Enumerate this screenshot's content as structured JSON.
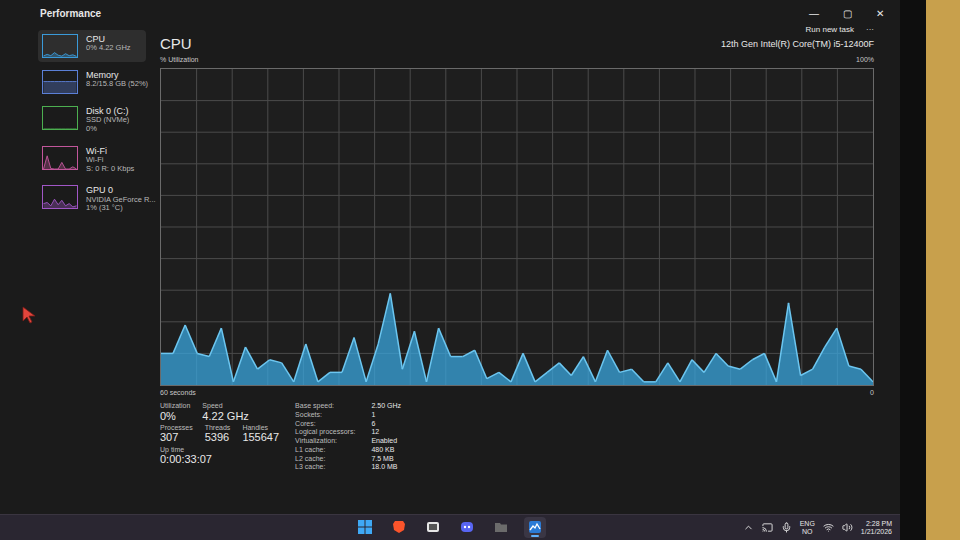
{
  "window": {
    "title": "Performance",
    "controls": [
      "—",
      "▢",
      "✕"
    ]
  },
  "toolbar": {
    "run_task": "Run new task",
    "more": "···"
  },
  "sidebar": {
    "items": [
      {
        "name": "CPU",
        "lines": [
          "0% 4.22 GHz"
        ],
        "selected": true,
        "color": "#3a9ad9",
        "values": [
          5,
          12,
          6,
          20,
          8,
          4,
          15,
          6,
          10,
          3
        ]
      },
      {
        "name": "Memory",
        "lines": [
          "8.2/15.8 GB (52%)"
        ],
        "selected": false,
        "color": "#5b7fd6",
        "values": [
          52,
          52,
          52,
          52,
          52,
          52,
          52,
          52,
          52,
          52
        ]
      },
      {
        "name": "Disk 0 (C:)",
        "lines": [
          "SSD (NVMe)",
          "0%"
        ],
        "selected": false,
        "color": "#4caf50",
        "values": [
          0,
          0,
          0,
          0,
          0,
          0,
          0,
          0,
          0,
          0
        ]
      },
      {
        "name": "Wi-Fi",
        "lines": [
          "Wi-Fi",
          "S: 0 R: 0 Kbps"
        ],
        "selected": false,
        "color": "#c2569b",
        "values": [
          0,
          60,
          2,
          0,
          0,
          30,
          0,
          0,
          10,
          0
        ]
      },
      {
        "name": "GPU 0",
        "lines": [
          "NVIDIA GeForce R...",
          "1% (31 °C)"
        ],
        "selected": false,
        "color": "#a157c7",
        "values": [
          20,
          25,
          10,
          40,
          15,
          35,
          10,
          20,
          5,
          10
        ]
      }
    ]
  },
  "cpu": {
    "title": "CPU",
    "model": "12th Gen Intel(R) Core(TM) i5-12400F",
    "chart": {
      "y_label": "% Utilization",
      "y_max": "100%",
      "x_label": "60 seconds",
      "y_min": "0",
      "values": [
        10,
        10,
        19,
        10,
        9,
        18,
        1,
        12,
        5,
        8,
        7,
        1,
        13,
        1,
        4,
        4,
        15,
        1,
        13,
        29,
        5,
        17,
        1,
        18,
        9,
        9,
        11,
        2,
        4,
        1,
        10,
        1,
        4,
        7,
        3,
        9,
        1,
        11,
        4,
        5,
        1,
        1,
        7,
        1,
        8,
        4,
        10,
        6,
        5,
        8,
        10,
        1,
        26,
        3,
        5,
        12,
        18,
        6,
        5,
        1
      ]
    }
  },
  "stats_rows": [
    {
      "cells": [
        {
          "label": "Utilization",
          "value": "0%"
        },
        {
          "label": "Speed",
          "value": "4.22 GHz"
        }
      ]
    },
    {
      "cells": [
        {
          "label": "Processes",
          "value": "307"
        },
        {
          "label": "Threads",
          "value": "5396"
        },
        {
          "label": "Handles",
          "value": "155647"
        }
      ]
    },
    {
      "cells": [
        {
          "label": "Up time",
          "value": "0:00:33:07"
        }
      ]
    }
  ],
  "details": [
    {
      "label": "Base speed:",
      "value": "2.50 GHz"
    },
    {
      "label": "Sockets:",
      "value": "1"
    },
    {
      "label": "Cores:",
      "value": "6"
    },
    {
      "label": "Logical processors:",
      "value": "12"
    },
    {
      "label": "Virtualization:",
      "value": "Enabled"
    },
    {
      "label": "L1 cache:",
      "value": "480 KB"
    },
    {
      "label": "L2 cache:",
      "value": "7.5 MB"
    },
    {
      "label": "L3 cache:",
      "value": "18.0 MB"
    }
  ],
  "taskbar": {
    "apps": [
      {
        "kind": "windows",
        "selected": false
      },
      {
        "kind": "brave",
        "selected": false
      },
      {
        "kind": "app",
        "selected": false
      },
      {
        "kind": "discord",
        "selected": false
      },
      {
        "kind": "folder",
        "selected": false
      },
      {
        "kind": "taskmgr",
        "selected": true
      }
    ],
    "language": [
      "ENG",
      "NO"
    ],
    "time": "2:28 PM",
    "date": "1/21/2026"
  }
}
